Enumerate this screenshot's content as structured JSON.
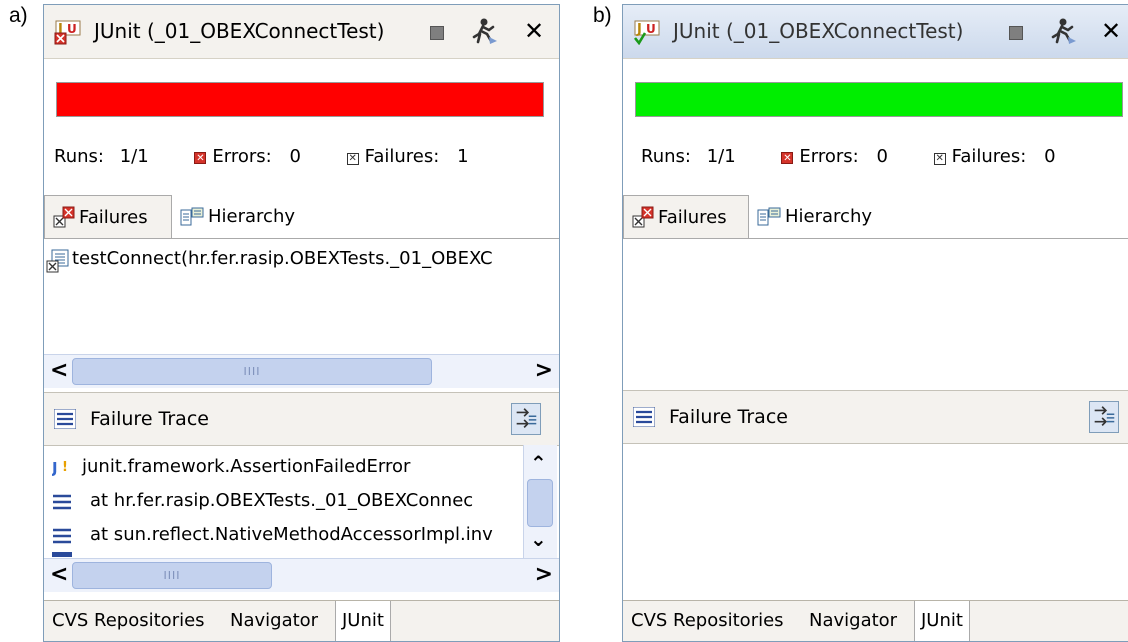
{
  "panels": [
    {
      "label": "a)",
      "title": "JUnit (_01_OBEXConnectTest)",
      "status_color": "#ff0000",
      "counters": {
        "runs_label": "Runs:",
        "runs_value": "1/1",
        "errors_label": "Errors:",
        "errors_value": "0",
        "failures_label": "Failures:",
        "failures_value": "1"
      },
      "tabs": {
        "failures": "Failures",
        "hierarchy": "Hierarchy"
      },
      "failures_list": [
        "testConnect(hr.fer.rasip.OBEXTests._01_OBEXC"
      ],
      "trace_title": "Failure Trace",
      "trace_rows": [
        "junit.framework.AssertionFailedError",
        "at hr.fer.rasip.OBEXTests._01_OBEXConnec",
        "at sun.reflect.NativeMethodAccessorImpl.inv"
      ],
      "bottom_tabs": [
        "CVS Repositories",
        "Navigator",
        "JUnit"
      ]
    },
    {
      "label": "b)",
      "title": "JUnit (_01_OBEXConnectTest)",
      "status_color": "#00ee00",
      "counters": {
        "runs_label": "Runs:",
        "runs_value": "1/1",
        "errors_label": "Errors:",
        "errors_value": "0",
        "failures_label": "Failures:",
        "failures_value": "0"
      },
      "tabs": {
        "failures": "Failures",
        "hierarchy": "Hierarchy"
      },
      "trace_title": "Failure Trace",
      "bottom_tabs": [
        "CVS Repositories",
        "Navigator",
        "JUnit"
      ]
    }
  ],
  "icons": {
    "junit_fail": "junit-failed-icon",
    "junit_pass": "junit-passed-icon",
    "stop": "stop-icon",
    "rerun": "rerun-icon",
    "close": "close-icon",
    "error": "error-icon",
    "failure": "failure-icon",
    "hierarchy": "hierarchy-icon",
    "trace": "stack-trace-icon",
    "filter": "filter-stack-icon"
  }
}
